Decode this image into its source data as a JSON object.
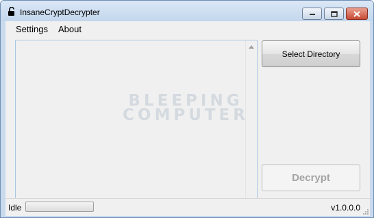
{
  "window": {
    "title": "InsaneCryptDecrypter"
  },
  "menu": {
    "settings": "Settings",
    "about": "About"
  },
  "buttons": {
    "select_directory": "Select Directory",
    "decrypt": "Decrypt"
  },
  "watermark": {
    "line1": "BLEEPING",
    "line2": "COMPUTER"
  },
  "status": {
    "state": "Idle",
    "progress_fraction": 0,
    "version": "v1.0.0.0"
  },
  "icons": {
    "app": "unlocked-padlock-icon",
    "minimize": "minimize-icon",
    "maximize": "maximize-icon",
    "close": "close-icon"
  }
}
